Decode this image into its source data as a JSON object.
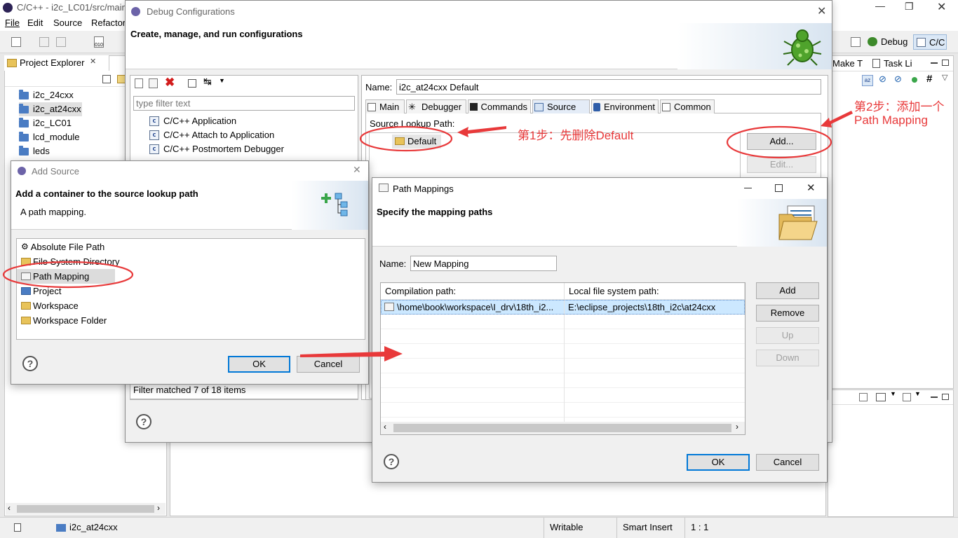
{
  "workbench": {
    "window_title": "C/C++ - i2c_LC01/src/main",
    "menus": [
      "File",
      "Edit",
      "Source",
      "Refactor"
    ],
    "perspectives": {
      "debug": "Debug",
      "cc": "C/C"
    },
    "explorer_tab": "Project Explorer",
    "projects": [
      "i2c_24cxx",
      "i2c_at24cxx",
      "i2c_LC01",
      "lcd_module",
      "leds"
    ],
    "right_tabs": {
      "make": "Make T",
      "task": "Task Li"
    },
    "status": {
      "selected_project": "i2c_at24cxx",
      "writable": "Writable",
      "insert_mode": "Smart Insert",
      "position": "1 : 1"
    }
  },
  "debug_dialog": {
    "title": "Debug Configurations",
    "banner_text": "Create, manage, and run configurations",
    "filter_placeholder": "type filter text",
    "config_types": [
      "C/C++ Application",
      "C/C++ Attach to Application",
      "C/C++ Postmortem Debugger"
    ],
    "filter_status": "Filter matched 7 of 18 items",
    "name_label": "Name:",
    "name_value": "i2c_at24cxx Default",
    "tabs": [
      "Main",
      "Debugger",
      "Commands",
      "Source",
      "Environment",
      "Common"
    ],
    "active_tab": "Source",
    "source_lookup_label": "Source Lookup Path:",
    "source_entries": [
      "Default"
    ],
    "buttons": {
      "add": "Add...",
      "edit": "Edit..."
    }
  },
  "add_source_dialog": {
    "title": "Add Source",
    "heading": "Add a container to the source lookup path",
    "description": "A path mapping.",
    "items": [
      "Absolute File Path",
      "File System Directory",
      "Path Mapping",
      "Project",
      "Workspace",
      "Workspace Folder"
    ],
    "selected_item": "Path Mapping",
    "ok": "OK",
    "cancel": "Cancel"
  },
  "path_mappings_dialog": {
    "title": "Path Mappings",
    "heading": "Specify the mapping paths",
    "name_label": "Name:",
    "name_value": "New Mapping",
    "columns": [
      "Compilation path:",
      "Local file system path:"
    ],
    "rows": [
      {
        "compilation": "\\home\\book\\workspace\\I_drv\\18th_i2...",
        "local": "E:\\eclipse_projects\\18th_i2c\\at24cxx"
      }
    ],
    "buttons": {
      "add": "Add",
      "remove": "Remove",
      "up": "Up",
      "down": "Down",
      "ok": "OK",
      "cancel": "Cancel"
    }
  },
  "annotations": {
    "step1": "第1步：先删除Default",
    "step2_line1": "第2步：添加一个",
    "step2_line2": "Path Mapping",
    "color": "#e8393a"
  }
}
